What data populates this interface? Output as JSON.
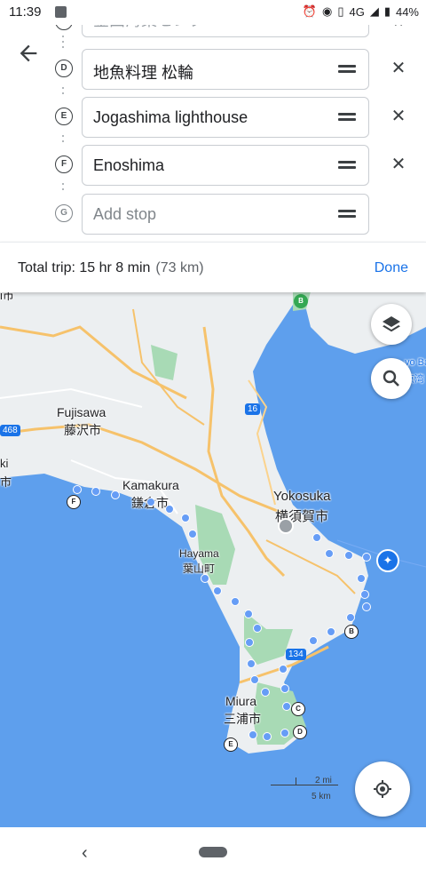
{
  "status": {
    "time": "11:39",
    "network": "4G",
    "battery": "44%"
  },
  "stops": {
    "top_partial": {
      "text": "金田海業センター"
    },
    "items": [
      {
        "letter": "D",
        "text": "地魚料理 松輪"
      },
      {
        "letter": "E",
        "text": "Jogashima lighthouse"
      },
      {
        "letter": "F",
        "text": "Enoshima"
      }
    ],
    "add": {
      "letter": "G",
      "placeholder": "Add stop"
    }
  },
  "trip": {
    "summary": "Total trip: 15 hr 8 min",
    "distance": "(73 km)",
    "done_label": "Done"
  },
  "map": {
    "places": [
      "Fujisawa",
      "藤沢市",
      "Kamakura",
      "鎌倉市",
      "Yokosuka",
      "横須賀市",
      "Hayama",
      "葉山町",
      "Miura",
      "三浦市"
    ],
    "edge_labels": [
      "i市",
      "ki",
      "市",
      "yo Ba",
      "京湾"
    ],
    "roads": [
      "16",
      "134",
      "468"
    ],
    "pins": [
      "B",
      "C",
      "D",
      "E",
      "F",
      "B"
    ],
    "scale": {
      "mi": "2 mi",
      "km": "5 km"
    }
  },
  "colors": {
    "accent": "#1a73e8",
    "water": "#5e9fed",
    "route": "#669df6"
  }
}
